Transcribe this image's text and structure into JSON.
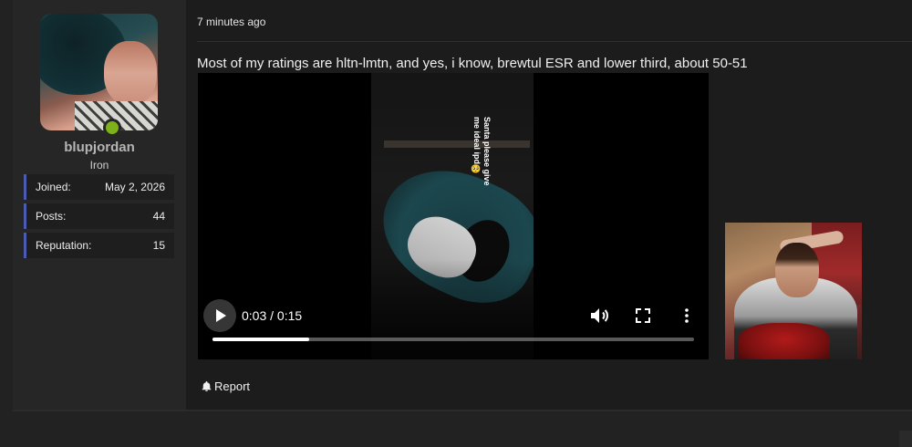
{
  "user": {
    "username": "blupjordan",
    "rank": "Iron",
    "stats": [
      {
        "label": "Joined:",
        "value": "May 2, 2026"
      },
      {
        "label": "Posts:",
        "value": "44"
      },
      {
        "label": "Reputation:",
        "value": "15"
      }
    ],
    "online_color": "#7cb11a"
  },
  "post": {
    "time": "7 minutes ago",
    "text": "Most of my ratings are hltn-lmtn, and yes, i know, brewtul ESR and lower third, about 50-51",
    "video": {
      "caption": "Santa please give me ideal ipd🥺",
      "time_display": "0:03 / 0:15",
      "progress_fraction": 0.2,
      "play_icon": "play-icon",
      "volume_icon": "volume-icon",
      "fullscreen_icon": "fullscreen-icon",
      "more_icon": "more-vertical-icon"
    },
    "report_label": "Report",
    "report_icon": "bell-icon"
  },
  "colors": {
    "accent": "#4a5bb0",
    "background": "#222222",
    "panel": "#262626"
  }
}
